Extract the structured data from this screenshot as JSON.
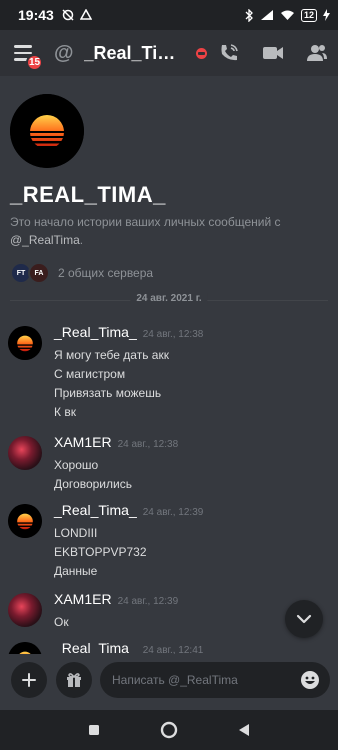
{
  "statusbar": {
    "time": "19:43",
    "battery": "12"
  },
  "header": {
    "badge": "15",
    "at_symbol": "@",
    "title": "_Real_Tima..."
  },
  "intro": {
    "title": "_REAL_TIMA_",
    "desc_prefix": "Это начало истории ваших личных сообщений с ",
    "desc_user": "@_RealTima",
    "desc_suffix": ".",
    "server1_tag": "FT",
    "server2_tag": "FA",
    "mutual_servers": "2 общих сервера"
  },
  "divider_date": "24 авг. 2021 г.",
  "messages": [
    {
      "author": "_Real_Tima_",
      "time": "24 авг., 12:38",
      "lines": [
        "Я могу тебе дать акк",
        "С магистром",
        "Привязать можешь",
        "К вк"
      ]
    },
    {
      "author": "XAM1ER",
      "time": "24 авг., 12:38",
      "lines": [
        "Хорошо",
        "Договорились"
      ]
    },
    {
      "author": "_Real_Tima_",
      "time": "24 авг., 12:39",
      "lines": [
        "LONDIII",
        "EKBTOPPVP732",
        "Данные"
      ]
    },
    {
      "author": "XAM1ER",
      "time": "24 авг., 12:39",
      "lines": [
        "Ок"
      ]
    },
    {
      "author": "_Real_Tima_",
      "time": "24 авг., 12:41",
      "lines": []
    }
  ],
  "input": {
    "placeholder": "Написать @_RealTima"
  },
  "colors": {
    "background": "#36393f",
    "header": "#2f3136",
    "dark": "#202225",
    "badge": "#ed4245",
    "dnd": "#ed4245"
  },
  "icons": [
    "hamburger-icon",
    "phone-call-icon",
    "video-camera-icon",
    "people-icon",
    "plus-icon",
    "gift-icon",
    "emoji-icon",
    "chevron-down-icon",
    "nav-square-icon",
    "nav-circle-icon",
    "nav-back-icon"
  ]
}
